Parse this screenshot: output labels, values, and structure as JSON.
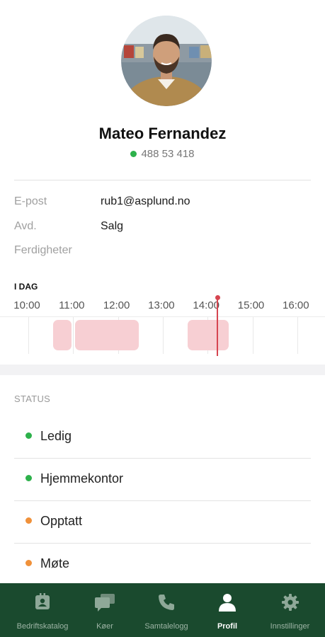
{
  "profile": {
    "name": "Mateo Fernandez",
    "phone": "488 53 418",
    "presence_color": "#2db14b"
  },
  "details": [
    {
      "label": "E-post",
      "value": "rub1@asplund.no"
    },
    {
      "label": "Avd.",
      "value": "Salg"
    },
    {
      "label": "Ferdigheter",
      "value": ""
    }
  ],
  "calendar": {
    "title": "I DAG",
    "hours": [
      "10:00",
      "11:00",
      "12:00",
      "13:00",
      "14:00",
      "15:00",
      "16:00"
    ],
    "busy_color": "#f7cfd3",
    "now_color": "#d64550"
  },
  "status": {
    "header": "STATUS",
    "items": [
      {
        "label": "Ledig",
        "color": "#2db14b"
      },
      {
        "label": "Hjemmekontor",
        "color": "#2db14b"
      },
      {
        "label": "Opptatt",
        "color": "#f0913a"
      },
      {
        "label": "Møte",
        "color": "#f0913a"
      }
    ]
  },
  "tabbar": {
    "background": "#1a4a2e",
    "items": [
      {
        "label": "Bedriftskatalog",
        "icon": "contacts-book-icon",
        "active": false
      },
      {
        "label": "Køer",
        "icon": "chat-bubbles-icon",
        "active": false
      },
      {
        "label": "Samtalelogg",
        "icon": "phone-icon",
        "active": false
      },
      {
        "label": "Profil",
        "icon": "person-icon",
        "active": true
      },
      {
        "label": "Innstillinger",
        "icon": "gear-icon",
        "active": false
      }
    ]
  }
}
